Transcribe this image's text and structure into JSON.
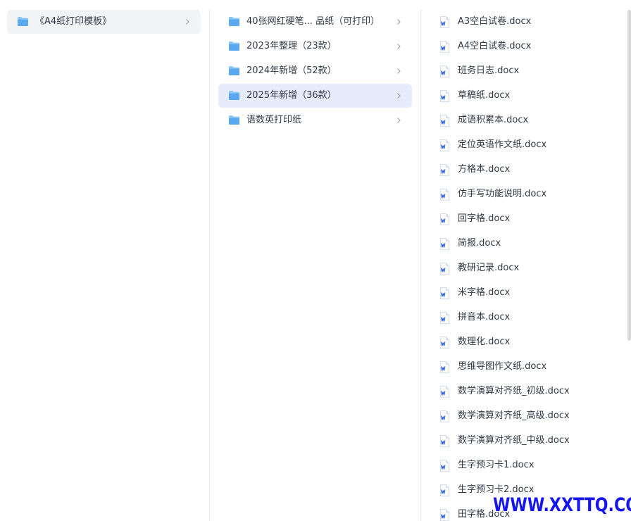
{
  "colors": {
    "folder": "#6bb3f2",
    "selected_gray": "#f2f3f5",
    "selected_blue": "#e6ecfc",
    "word_icon": "#2b5fd9",
    "watermark": "#1515ef"
  },
  "column1": {
    "items": [
      {
        "label": "《A4纸打印模板》",
        "icon": "folder-icon",
        "selected": true
      }
    ]
  },
  "column2": {
    "items": [
      {
        "label": "40张网红硬笔... 品纸（可打印）",
        "icon": "folder-icon",
        "selected": false
      },
      {
        "label": "2023年整理（23款）",
        "icon": "folder-icon",
        "selected": false
      },
      {
        "label": "2024年新增（52款）",
        "icon": "folder-icon",
        "selected": false
      },
      {
        "label": "2025年新增（36款）",
        "icon": "folder-icon",
        "selected": true
      },
      {
        "label": "语数英打印纸",
        "icon": "folder-icon",
        "selected": false
      }
    ]
  },
  "column3": {
    "items": [
      {
        "label": "A3空白试卷.docx",
        "icon": "word-file-icon"
      },
      {
        "label": "A4空白试卷.docx",
        "icon": "word-file-icon"
      },
      {
        "label": "班务日志.docx",
        "icon": "word-file-icon"
      },
      {
        "label": "草稿纸.docx",
        "icon": "word-file-icon"
      },
      {
        "label": "成语积累本.docx",
        "icon": "word-file-icon"
      },
      {
        "label": "定位英语作文纸.docx",
        "icon": "word-file-icon"
      },
      {
        "label": "方格本.docx",
        "icon": "word-file-icon"
      },
      {
        "label": "仿手写功能说明.docx",
        "icon": "word-file-icon"
      },
      {
        "label": "回字格.docx",
        "icon": "word-file-icon"
      },
      {
        "label": "简报.docx",
        "icon": "word-file-icon"
      },
      {
        "label": "教研记录.docx",
        "icon": "word-file-icon"
      },
      {
        "label": "米字格.docx",
        "icon": "word-file-icon"
      },
      {
        "label": "拼音本.docx",
        "icon": "word-file-icon"
      },
      {
        "label": "数理化.docx",
        "icon": "word-file-icon"
      },
      {
        "label": "思维导图作文纸.docx",
        "icon": "word-file-icon"
      },
      {
        "label": "数学演算对齐纸_初级.docx",
        "icon": "word-file-icon"
      },
      {
        "label": "数学演算对齐纸_高级.docx",
        "icon": "word-file-icon"
      },
      {
        "label": "数学演算对齐纸_中级.docx",
        "icon": "word-file-icon"
      },
      {
        "label": "生字预习卡1.docx",
        "icon": "word-file-icon"
      },
      {
        "label": "生字预习卡2.docx",
        "icon": "word-file-icon"
      },
      {
        "label": "田字格.docx",
        "icon": "word-file-icon"
      }
    ]
  },
  "watermark": {
    "text": "WWW.XXTTQ.COM"
  }
}
